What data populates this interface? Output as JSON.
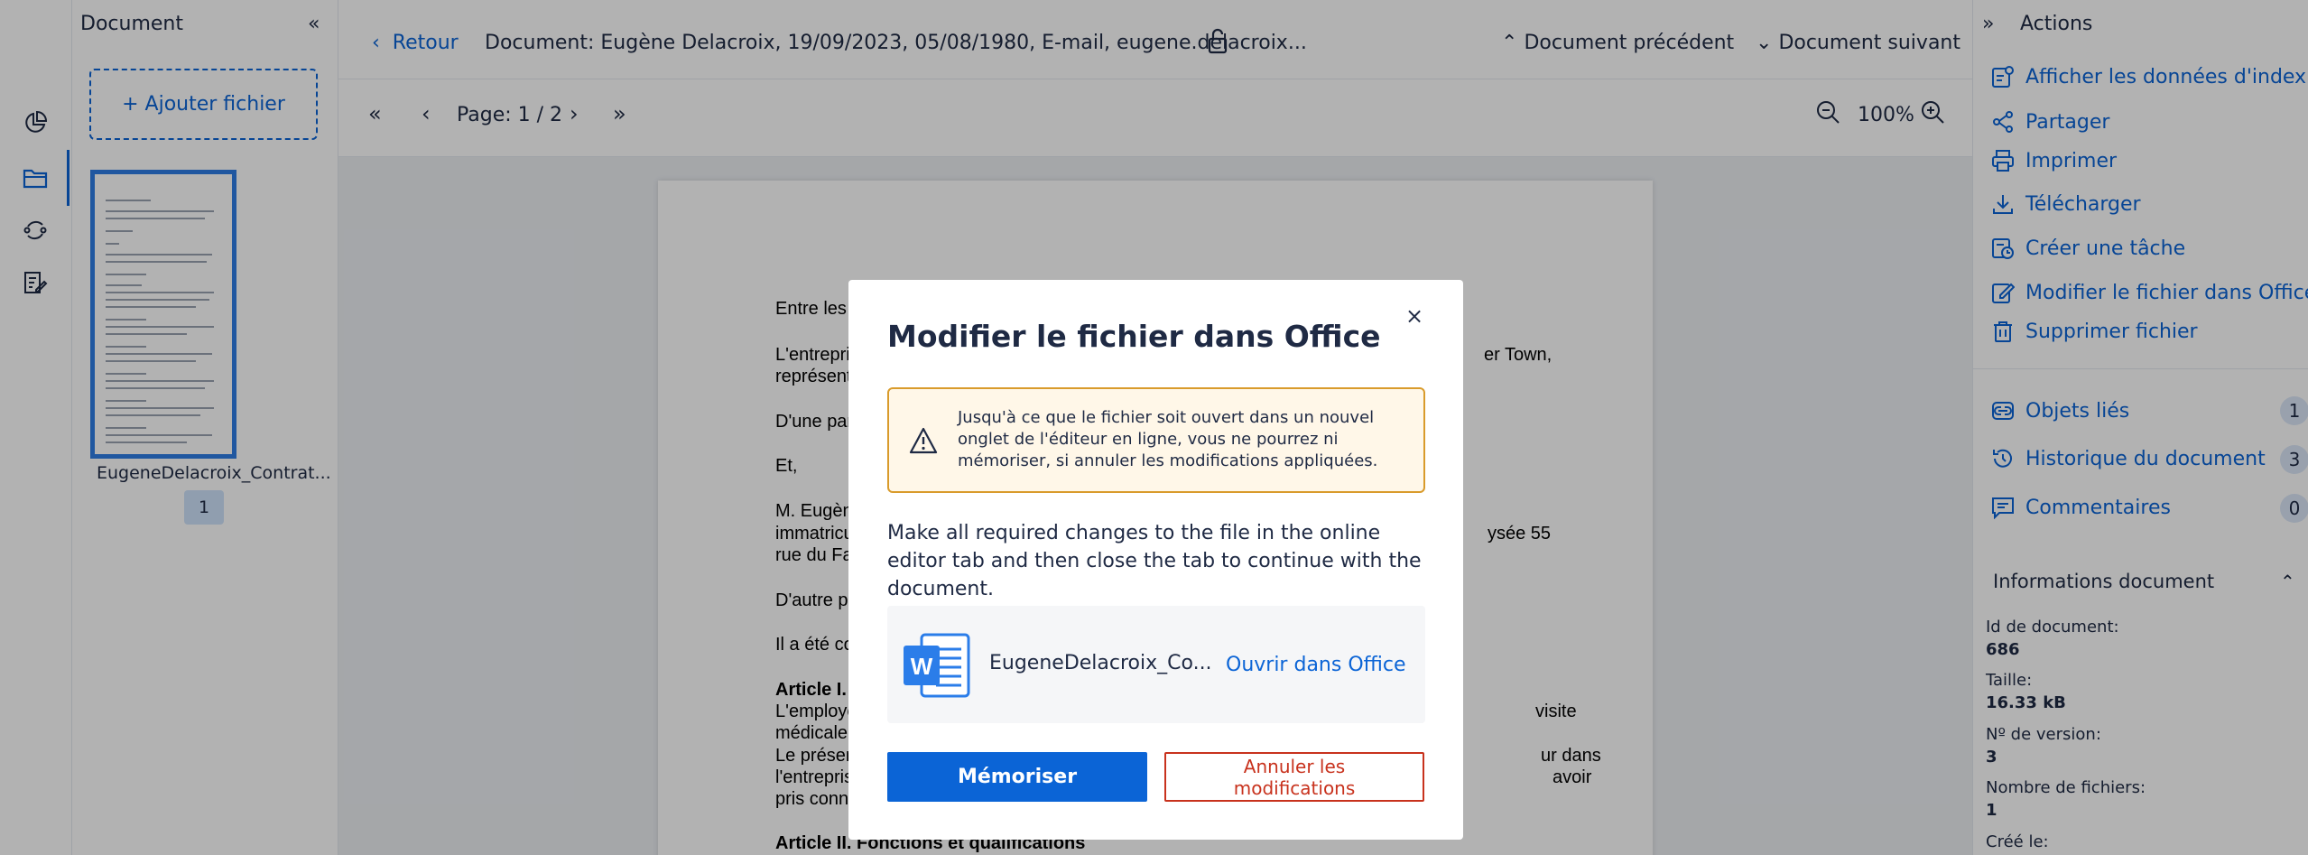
{
  "left_panel": {
    "title": "Document",
    "add_file_label": "+ Ajouter fichier",
    "thumbnail_name": "EugeneDelacroix_Contrat...",
    "thumbnail_page": "1"
  },
  "topbar": {
    "back_label": "Retour",
    "document_title": "Document: Eugène Delacroix, 19/09/2023, 05/08/1980, E-mail, eugene.delacroix...",
    "prev_label": "Document précédent",
    "next_label": "Document suivant"
  },
  "pagebar": {
    "page_label": "Page: 1 / 2",
    "zoom": "100%"
  },
  "document_text": {
    "l1": "Entre les",
    "l2a": "L'entrepri",
    "l2b": "er Town,",
    "l3": "représent",
    "l4": "D'une par",
    "l5": "Et,",
    "l6": "M. Eugèn",
    "l7a": "immatricu",
    "l7b": "ysée 55",
    "l8": "rue du Fa",
    "l9": "D'autre pa",
    "l10": "Il a été co",
    "l11": "Article I.",
    "l12a": "L'employe",
    "l12b": "visite",
    "l13": "médicale",
    "l14a": "Le présen",
    "l14b": "ur dans",
    "l15a": "l'entrepris",
    "l15b": "avoir",
    "l16": "pris conn",
    "l17": "Article II. Fonctions et qualifications"
  },
  "actions": {
    "title": "Actions",
    "items": [
      {
        "label": "Afficher les données d'index",
        "icon": "index-data-icon"
      },
      {
        "label": "Partager",
        "icon": "share-icon"
      },
      {
        "label": "Imprimer",
        "icon": "print-icon"
      },
      {
        "label": "Télécharger",
        "icon": "download-icon"
      },
      {
        "label": "Créer une tâche",
        "icon": "task-icon"
      },
      {
        "label": "Modifier le fichier dans Office",
        "icon": "edit-icon"
      },
      {
        "label": "Supprimer fichier",
        "icon": "trash-icon"
      }
    ],
    "related": [
      {
        "label": "Objets liés",
        "count": "1",
        "icon": "link-icon"
      },
      {
        "label": "Historique du document",
        "count": "3",
        "icon": "history-icon"
      },
      {
        "label": "Commentaires",
        "count": "0",
        "icon": "comment-icon"
      }
    ],
    "info_title": "Informations document",
    "info": [
      {
        "key": "Id de document:",
        "value": "686"
      },
      {
        "key": "Taille:",
        "value": "16.33 kB"
      },
      {
        "key": "Nº de version:",
        "value": "3"
      },
      {
        "key": "Nombre de fichiers:",
        "value": "1"
      },
      {
        "key": "Créé le:",
        "value": ""
      }
    ]
  },
  "modal": {
    "title": "Modifier le fichier dans Office",
    "close": "×",
    "warning": "Jusqu'à ce que le fichier soit ouvert dans un nouvel onglet de l'éditeur en ligne, vous ne pourrez ni mémoriser, si annuler les modifications appliquées.",
    "body": "Make all required changes to the file in the online editor tab and then close the tab to continue with the document.",
    "file_name": "EugeneDelacroix_Co...",
    "open_label": "Ouvrir dans Office",
    "primary_label": "Mémoriser",
    "cancel_label": "Annuler les modifications"
  },
  "colors": {
    "accent": "#0b64d6",
    "danger": "#c8321d",
    "warning_border": "#d99b2b",
    "warning_bg": "#fff7e8"
  }
}
